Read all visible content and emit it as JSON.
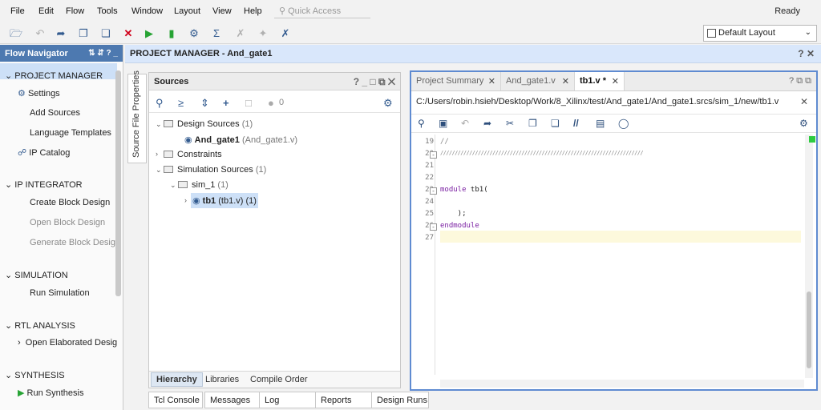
{
  "menu": [
    "File",
    "Edit",
    "Flow",
    "Tools",
    "Window",
    "Layout",
    "View",
    "Help"
  ],
  "quick_access_placeholder": "Quick Access",
  "status": "Ready",
  "layout_select": "Default Layout",
  "flow_navigator": {
    "title": "Flow Navigator",
    "sections": [
      {
        "label": "PROJECT MANAGER",
        "items": [
          {
            "label": "Settings",
            "icon": "gear-icon"
          },
          {
            "label": "Add Sources"
          },
          {
            "label": "Language Templates"
          },
          {
            "label": "IP Catalog",
            "icon": "ip-icon"
          }
        ]
      },
      {
        "label": "IP INTEGRATOR",
        "items": [
          {
            "label": "Create Block Design"
          },
          {
            "label": "Open Block Design"
          },
          {
            "label": "Generate Block Design"
          }
        ]
      },
      {
        "label": "SIMULATION",
        "items": [
          {
            "label": "Run Simulation"
          }
        ]
      },
      {
        "label": "RTL ANALYSIS",
        "items": [
          {
            "label": "Open Elaborated Desig"
          }
        ]
      },
      {
        "label": "SYNTHESIS",
        "items": [
          {
            "label": "Run Synthesis"
          }
        ]
      }
    ]
  },
  "project_header": "PROJECT MANAGER - And_gate1",
  "source_file_properties_tab": "Source File Properties",
  "sources": {
    "title": "Sources",
    "badge_count": "0",
    "tree": {
      "design_sources": "Design Sources",
      "design_sources_count": "(1)",
      "and_gate_name": "And_gate1",
      "and_gate_file": "(And_gate1.v)",
      "constraints": "Constraints",
      "simulation_sources": "Simulation Sources",
      "simulation_sources_count": "(1)",
      "sim_1": "sim_1",
      "sim_1_count": "(1)",
      "tb1_name": "tb1",
      "tb1_file": "(tb1.v) (1)"
    },
    "bottom_tabs": [
      "Hierarchy",
      "Libraries",
      "Compile Order"
    ]
  },
  "bottom_panel_tabs": [
    "Tcl Console",
    "Messages",
    "Log",
    "Reports",
    "Design Runs"
  ],
  "editor": {
    "tabs": [
      "Project Summary",
      "And_gate1.v",
      "tb1.v *"
    ],
    "file_path": "C:/Users/robin.hsieh/Desktop/Work/8_Xilinx/test/And_gate1/And_gate1.srcs/sim_1/new/tb1.v",
    "line_numbers": [
      "19",
      "20",
      "21",
      "22",
      "23",
      "24",
      "25",
      "26",
      "27"
    ],
    "code": {
      "line19": "//",
      "line20": "//////////////////////////////////////////////////////////////////////",
      "line23_kw": "module",
      "line23_rest": " tb1(",
      "line25": "    );",
      "line26_kw": "endmodule"
    }
  }
}
